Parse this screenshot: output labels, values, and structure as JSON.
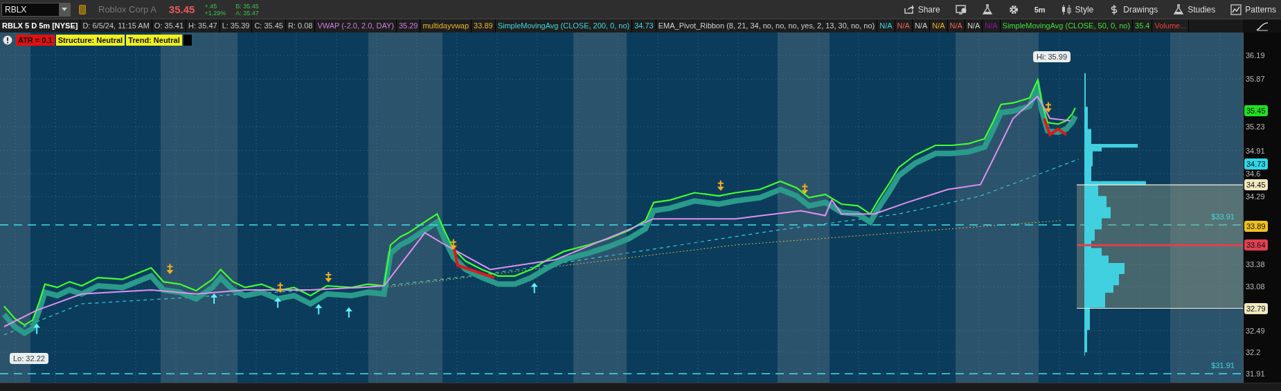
{
  "toolbar": {
    "symbol": "RBLX",
    "company": "Roblox Corp A",
    "last": "35.45",
    "change": "+.45",
    "change_pct": "+1.29%",
    "bid": "B: 35.45",
    "ask": "A: 35.47",
    "buttons": [
      {
        "kind": "share",
        "label": "Share"
      },
      {
        "kind": "alert"
      },
      {
        "kind": "flask"
      },
      {
        "kind": "gear"
      },
      {
        "kind": "plain",
        "label": "5m"
      },
      {
        "kind": "style",
        "label": "Style"
      },
      {
        "kind": "dollar",
        "label": "Drawings"
      },
      {
        "kind": "flask",
        "label": "Studies"
      },
      {
        "kind": "patterns",
        "label": "Patterns"
      }
    ]
  },
  "study_bar": [
    {
      "text": "RBLX 5 D 5m [NYSE]",
      "color": "#ffffff"
    },
    {
      "text": "D: 6/5/24, 11:15 AM",
      "color": "#c8c8c8"
    },
    {
      "text": "O: 35.41",
      "color": "#c8c8c8"
    },
    {
      "text": "H: 35.47",
      "color": "#c8c8c8"
    },
    {
      "text": "L: 35.39",
      "color": "#c8c8c8"
    },
    {
      "text": "C: 35.45",
      "color": "#c8c8c8"
    },
    {
      "text": "R: 0.08",
      "color": "#c8c8c8"
    },
    {
      "text": "VWAP (-2.0, 2.0, DAY)",
      "color": "#d07ee0"
    },
    {
      "text": "35.29",
      "color": "#d07ee0"
    },
    {
      "text": "multidayvwap",
      "color": "#e8b830"
    },
    {
      "text": "33.89",
      "color": "#e8b830"
    },
    {
      "text": "SimpleMovingAvg (CLOSE, 200, 0, no)",
      "color": "#40d8e0"
    },
    {
      "text": "34.73",
      "color": "#40d8e0"
    },
    {
      "text": "EMA_Pivot_Ribbon (8, 21, 34, no, no, no, yes, 2, 13, 30, no, no)",
      "color": "#d0d0d0"
    },
    {
      "text": "N/A",
      "color": "#40d8e0"
    },
    {
      "text": "N/A",
      "color": "#f06060"
    },
    {
      "text": "N/A",
      "color": "#d0d0d0"
    },
    {
      "text": "N/A",
      "color": "#e8b830"
    },
    {
      "text": "N/A",
      "color": "#f06060"
    },
    {
      "text": "N/A",
      "color": "#d0d0d0"
    },
    {
      "text": "N/A",
      "color": "#8a1a9a"
    },
    {
      "text": "SimpleMovingAvg (CLOSE, 50, 0, no)",
      "color": "#40e040"
    },
    {
      "text": "35.4",
      "color": "#40e040"
    },
    {
      "text": "Volume...",
      "color": "#f04040"
    }
  ],
  "indicator_labels": [
    {
      "text": "ATR = 0.1",
      "color": "#e01010"
    },
    {
      "text": "Structure: Neutral",
      "color": "#f0f020"
    },
    {
      "text": "Trend: Neutral",
      "color": "#f0f020"
    }
  ],
  "chart": {
    "high_label": "Hi: 35.99",
    "low_label": "Lo: 32.22",
    "levels": [
      {
        "label": "$33.91"
      },
      {
        "label": "$31.91"
      }
    ],
    "price_ticks": [
      "36.19",
      "35.87",
      "35.23",
      "34.91",
      "34.6",
      "34.29",
      "33.38",
      "33.08",
      "32.49",
      "32.2",
      "31.91"
    ],
    "price_tags": [
      {
        "label": "35.45",
        "color": "#20e020"
      },
      {
        "label": "34.73",
        "color": "#30d8e8"
      },
      {
        "label": "34.45",
        "color": "#f0e8c0"
      },
      {
        "label": "33.89",
        "color": "#f0c020"
      },
      {
        "label": "33.64",
        "color": "#e04050"
      },
      {
        "label": "32.79",
        "color": "#f0e8c0"
      }
    ]
  }
}
